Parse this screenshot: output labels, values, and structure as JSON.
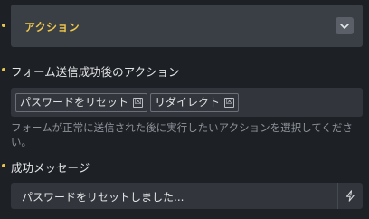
{
  "accordion": {
    "title": "アクション"
  },
  "actions_field": {
    "label": "フォーム送信成功後のアクション",
    "tags": [
      {
        "label": "パスワードをリセット",
        "remove": "☒"
      },
      {
        "label": "リダイレクト",
        "remove": "☒"
      }
    ],
    "help": "フォームが正常に送信された後に実行したいアクションを選択してください。"
  },
  "success_message": {
    "label": "成功メッセージ",
    "value": "パスワードをリセットしました..."
  },
  "icons": {
    "chevron": "chevron-down-icon",
    "bolt": "bolt-icon",
    "remove": "close-icon"
  },
  "colors": {
    "accent": "#f0c84a",
    "background": "#1d2024",
    "panel": "#3a3e45",
    "field": "#32363c"
  }
}
